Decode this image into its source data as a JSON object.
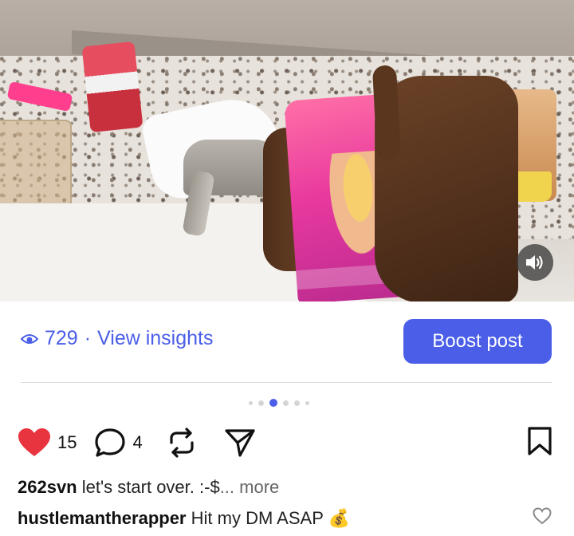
{
  "post": {
    "media_description_icon": "photo",
    "sound_button_icon": "speaker-icon"
  },
  "insights": {
    "views": "729",
    "separator": "·",
    "link_label": "View insights"
  },
  "boost": {
    "label": "Boost post"
  },
  "carousel": {
    "total": 6,
    "active_index": 2
  },
  "actions": {
    "likes": "15",
    "comments": "4"
  },
  "captions": [
    {
      "user": "262svn",
      "text": "let's start over. :-$",
      "more": "... more"
    },
    {
      "user": "hustlemantherapper",
      "text": "Hit my DM ASAP",
      "emoji": "💰"
    }
  ],
  "colors": {
    "accent": "#4a5ee8",
    "like": "#e8343f"
  }
}
